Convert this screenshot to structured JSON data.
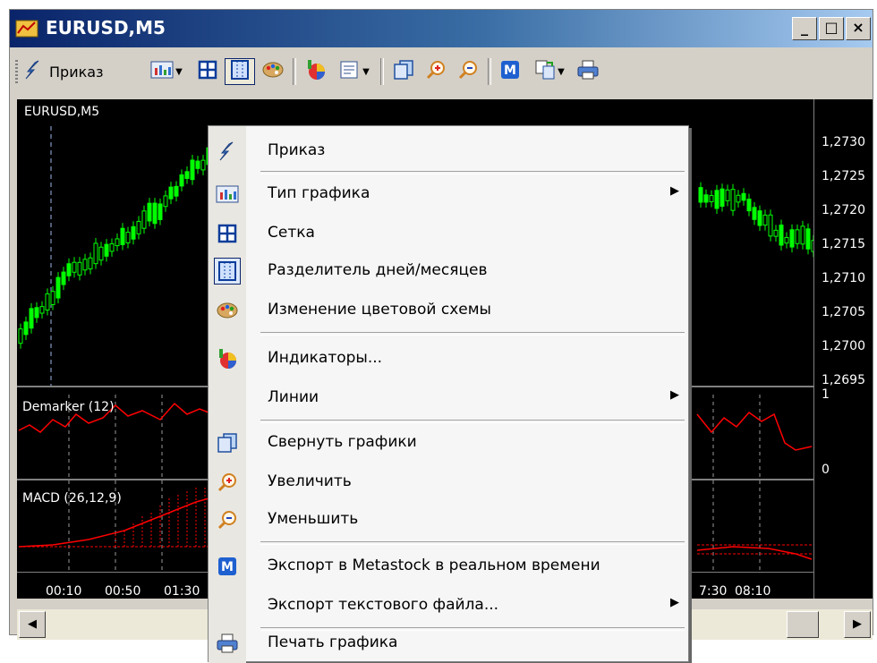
{
  "window": {
    "title": "EURUSD,M5",
    "minimize": "_",
    "maximize": "□",
    "close": "×"
  },
  "toolbar": {
    "order_label": "Приказ",
    "icons": [
      "order-icon",
      "chart-type-icon",
      "grid-icon",
      "period-separator-icon",
      "color-scheme-icon",
      "indicators-icon",
      "templates-icon",
      "tile-windows-icon",
      "zoom-in-icon",
      "zoom-out-icon",
      "metastock-icon",
      "export-icon",
      "print-icon"
    ]
  },
  "chart": {
    "symbol_label": "EURUSD,M5",
    "demarker_label": "Demarker (12)",
    "macd_label": "MACD (26,12,9)",
    "price_ticks": [
      "1,2730",
      "1,2725",
      "1,2720",
      "1,2715",
      "1,2710",
      "1,2705",
      "1,2700",
      "1,2695"
    ],
    "demarker_ticks": [
      "1",
      "0"
    ],
    "time_ticks": [
      "00:10",
      "00:50",
      "01:30",
      "7:30",
      "08:10"
    ],
    "colors": {
      "candle": "#00ff00",
      "indicator": "#ff0000",
      "grid": "#808080",
      "background": "#000000"
    }
  },
  "context_menu": {
    "items": [
      {
        "label": "Приказ",
        "icon": "order-icon",
        "submenu": false
      },
      {
        "label": "Тип графика",
        "icon": "chart-type-icon",
        "submenu": true
      },
      {
        "label": "Сетка",
        "icon": "grid-icon",
        "submenu": false
      },
      {
        "label": "Разделитель дней/месяцев",
        "icon": "period-separator-icon",
        "submenu": false
      },
      {
        "label": "Изменение цветовой схемы",
        "icon": "color-scheme-icon",
        "submenu": false
      },
      {
        "label": "Индикаторы...",
        "icon": "indicators-icon",
        "submenu": false
      },
      {
        "label": "Линии",
        "icon": "",
        "submenu": true
      },
      {
        "label": "Свернуть графики",
        "icon": "tile-windows-icon",
        "submenu": false
      },
      {
        "label": "Увеличить",
        "icon": "zoom-in-icon",
        "submenu": false
      },
      {
        "label": "Уменьшить",
        "icon": "zoom-out-icon",
        "submenu": false
      },
      {
        "label": "Экспорт в Metastock в реальном времени",
        "icon": "metastock-icon",
        "submenu": false
      },
      {
        "label": "Экспорт текстового файла...",
        "icon": "",
        "submenu": true
      },
      {
        "label": "Печать графика",
        "icon": "print-icon",
        "submenu": false
      }
    ],
    "submenu_arrow": "▶"
  },
  "scrollbar": {
    "left_arrow": "◀",
    "right_arrow": "▶"
  }
}
